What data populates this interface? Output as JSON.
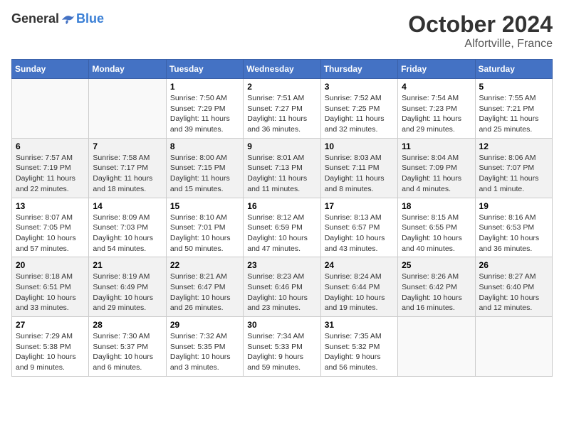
{
  "header": {
    "logo_general": "General",
    "logo_blue": "Blue",
    "month": "October 2024",
    "location": "Alfortville, France"
  },
  "calendar": {
    "days_of_week": [
      "Sunday",
      "Monday",
      "Tuesday",
      "Wednesday",
      "Thursday",
      "Friday",
      "Saturday"
    ],
    "weeks": [
      [
        {
          "day": "",
          "info": ""
        },
        {
          "day": "",
          "info": ""
        },
        {
          "day": "1",
          "info": "Sunrise: 7:50 AM\nSunset: 7:29 PM\nDaylight: 11 hours and 39 minutes."
        },
        {
          "day": "2",
          "info": "Sunrise: 7:51 AM\nSunset: 7:27 PM\nDaylight: 11 hours and 36 minutes."
        },
        {
          "day": "3",
          "info": "Sunrise: 7:52 AM\nSunset: 7:25 PM\nDaylight: 11 hours and 32 minutes."
        },
        {
          "day": "4",
          "info": "Sunrise: 7:54 AM\nSunset: 7:23 PM\nDaylight: 11 hours and 29 minutes."
        },
        {
          "day": "5",
          "info": "Sunrise: 7:55 AM\nSunset: 7:21 PM\nDaylight: 11 hours and 25 minutes."
        }
      ],
      [
        {
          "day": "6",
          "info": "Sunrise: 7:57 AM\nSunset: 7:19 PM\nDaylight: 11 hours and 22 minutes."
        },
        {
          "day": "7",
          "info": "Sunrise: 7:58 AM\nSunset: 7:17 PM\nDaylight: 11 hours and 18 minutes."
        },
        {
          "day": "8",
          "info": "Sunrise: 8:00 AM\nSunset: 7:15 PM\nDaylight: 11 hours and 15 minutes."
        },
        {
          "day": "9",
          "info": "Sunrise: 8:01 AM\nSunset: 7:13 PM\nDaylight: 11 hours and 11 minutes."
        },
        {
          "day": "10",
          "info": "Sunrise: 8:03 AM\nSunset: 7:11 PM\nDaylight: 11 hours and 8 minutes."
        },
        {
          "day": "11",
          "info": "Sunrise: 8:04 AM\nSunset: 7:09 PM\nDaylight: 11 hours and 4 minutes."
        },
        {
          "day": "12",
          "info": "Sunrise: 8:06 AM\nSunset: 7:07 PM\nDaylight: 11 hours and 1 minute."
        }
      ],
      [
        {
          "day": "13",
          "info": "Sunrise: 8:07 AM\nSunset: 7:05 PM\nDaylight: 10 hours and 57 minutes."
        },
        {
          "day": "14",
          "info": "Sunrise: 8:09 AM\nSunset: 7:03 PM\nDaylight: 10 hours and 54 minutes."
        },
        {
          "day": "15",
          "info": "Sunrise: 8:10 AM\nSunset: 7:01 PM\nDaylight: 10 hours and 50 minutes."
        },
        {
          "day": "16",
          "info": "Sunrise: 8:12 AM\nSunset: 6:59 PM\nDaylight: 10 hours and 47 minutes."
        },
        {
          "day": "17",
          "info": "Sunrise: 8:13 AM\nSunset: 6:57 PM\nDaylight: 10 hours and 43 minutes."
        },
        {
          "day": "18",
          "info": "Sunrise: 8:15 AM\nSunset: 6:55 PM\nDaylight: 10 hours and 40 minutes."
        },
        {
          "day": "19",
          "info": "Sunrise: 8:16 AM\nSunset: 6:53 PM\nDaylight: 10 hours and 36 minutes."
        }
      ],
      [
        {
          "day": "20",
          "info": "Sunrise: 8:18 AM\nSunset: 6:51 PM\nDaylight: 10 hours and 33 minutes."
        },
        {
          "day": "21",
          "info": "Sunrise: 8:19 AM\nSunset: 6:49 PM\nDaylight: 10 hours and 29 minutes."
        },
        {
          "day": "22",
          "info": "Sunrise: 8:21 AM\nSunset: 6:47 PM\nDaylight: 10 hours and 26 minutes."
        },
        {
          "day": "23",
          "info": "Sunrise: 8:23 AM\nSunset: 6:46 PM\nDaylight: 10 hours and 23 minutes."
        },
        {
          "day": "24",
          "info": "Sunrise: 8:24 AM\nSunset: 6:44 PM\nDaylight: 10 hours and 19 minutes."
        },
        {
          "day": "25",
          "info": "Sunrise: 8:26 AM\nSunset: 6:42 PM\nDaylight: 10 hours and 16 minutes."
        },
        {
          "day": "26",
          "info": "Sunrise: 8:27 AM\nSunset: 6:40 PM\nDaylight: 10 hours and 12 minutes."
        }
      ],
      [
        {
          "day": "27",
          "info": "Sunrise: 7:29 AM\nSunset: 5:38 PM\nDaylight: 10 hours and 9 minutes."
        },
        {
          "day": "28",
          "info": "Sunrise: 7:30 AM\nSunset: 5:37 PM\nDaylight: 10 hours and 6 minutes."
        },
        {
          "day": "29",
          "info": "Sunrise: 7:32 AM\nSunset: 5:35 PM\nDaylight: 10 hours and 3 minutes."
        },
        {
          "day": "30",
          "info": "Sunrise: 7:34 AM\nSunset: 5:33 PM\nDaylight: 9 hours and 59 minutes."
        },
        {
          "day": "31",
          "info": "Sunrise: 7:35 AM\nSunset: 5:32 PM\nDaylight: 9 hours and 56 minutes."
        },
        {
          "day": "",
          "info": ""
        },
        {
          "day": "",
          "info": ""
        }
      ]
    ]
  }
}
